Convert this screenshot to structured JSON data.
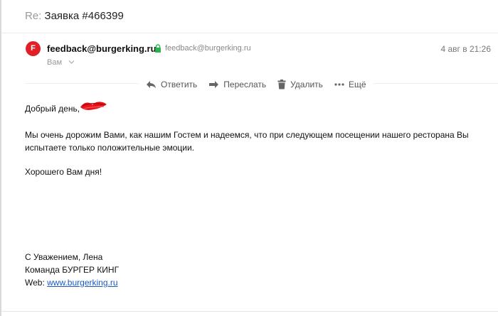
{
  "message": {
    "subject_prefix": "Re:",
    "subject": "Заявка #466399",
    "sender_initial": "F",
    "sender_name": "feedback@burgerking.ru",
    "sender_email": "feedback@burgerking.ru",
    "recipient": "Вам",
    "date": "4 авг в 21:26"
  },
  "toolbar": {
    "reply_label": "Ответить",
    "forward_label": "Переслать",
    "delete_label": "Удалить",
    "more_label": "Ещё"
  },
  "body": {
    "greeting": "Добрый день,",
    "paragraph": "Мы очень дорожим Вами, как нашим Гостем и надеемся, что при следующем посещении нашего ресторана Вы испытаете только положительные эмоции.",
    "wish": "Хорошего Вам дня!"
  },
  "signature": {
    "line1": "С Уважением, Лена",
    "line2": "Команда БУРГЕР КИНГ",
    "web_label": "Web:",
    "web_link": "www.burgerking.ru"
  },
  "colors": {
    "avatar": "#e01f26",
    "link": "#1a58c9",
    "scribble": "#e8141c",
    "lock": "#2bb24c"
  }
}
